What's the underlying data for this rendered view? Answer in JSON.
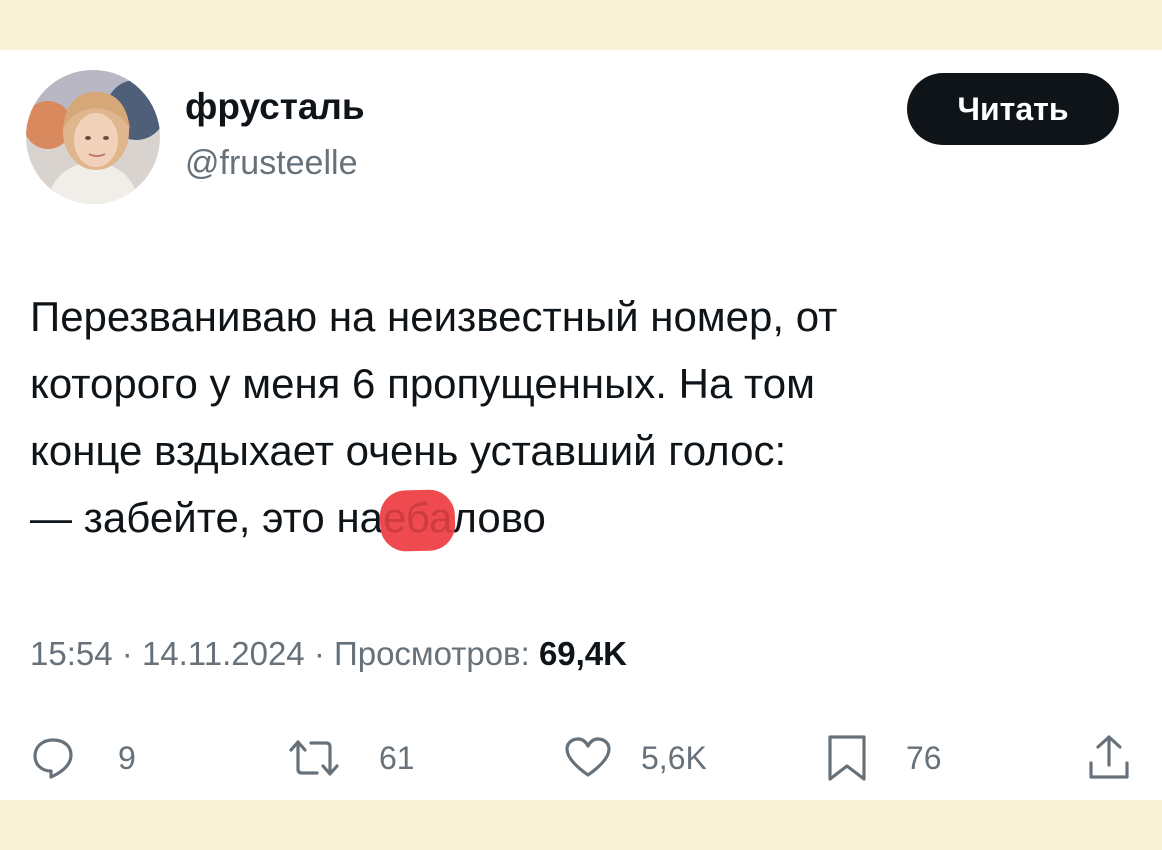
{
  "author": {
    "display_name": "фрусталь",
    "handle": "@frusteelle"
  },
  "follow_button": {
    "label": "Читать"
  },
  "tweet": {
    "lines": [
      "Перезваниваю на неизвестный номер, от",
      "которого у меня 6 пропущенных. На том",
      "конце вздыхает очень уставший голос:"
    ],
    "last_line_before": "— забейте, это на",
    "last_line_redacted": "еба",
    "last_line_after": "лово"
  },
  "meta": {
    "time": "15:54",
    "date": "14.11.2024",
    "views_label": "Просмотров:",
    "views_count": "69,4K",
    "separator": "·"
  },
  "actions": {
    "replies": "9",
    "retweets": "61",
    "likes": "5,6K",
    "bookmarks": "76"
  },
  "icons": {
    "reply": "reply-icon",
    "retweet": "retweet-icon",
    "like": "heart-icon",
    "bookmark": "bookmark-icon",
    "share": "share-icon"
  },
  "colors": {
    "background": "#f8f1d3",
    "card": "#ffffff",
    "text": "#0f1419",
    "secondary": "#67717a",
    "button": "#0f1419",
    "redaction": "#ee4a4f"
  }
}
